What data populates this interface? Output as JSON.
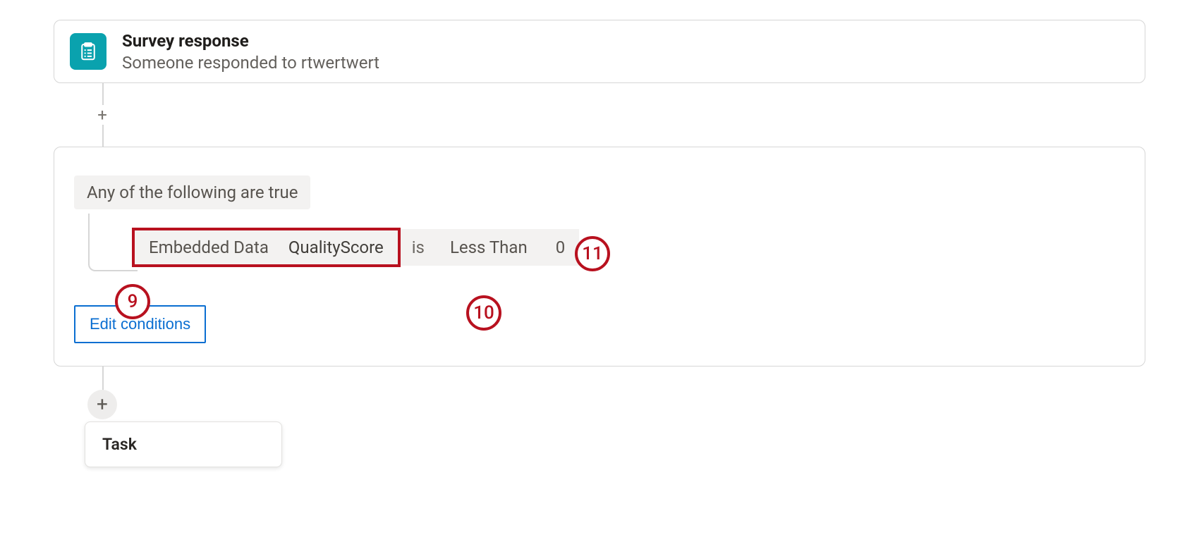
{
  "trigger": {
    "title": "Survey response",
    "subtitle": "Someone responded to rtwertwert"
  },
  "condition": {
    "header": "Any of the following are true",
    "clause1_category": "Embedded Data",
    "clause1_field": "QualityScore",
    "connector": "is",
    "operator": "Less Than",
    "value": "0",
    "edit_label": "Edit conditions"
  },
  "callouts": {
    "c9": "9",
    "c10": "10",
    "c11": "11"
  },
  "task": {
    "label": "Task"
  },
  "colors": {
    "icon_bg": "#0aa2ae",
    "callout_red": "#b8111f",
    "link_blue": "#0a6ed1"
  }
}
